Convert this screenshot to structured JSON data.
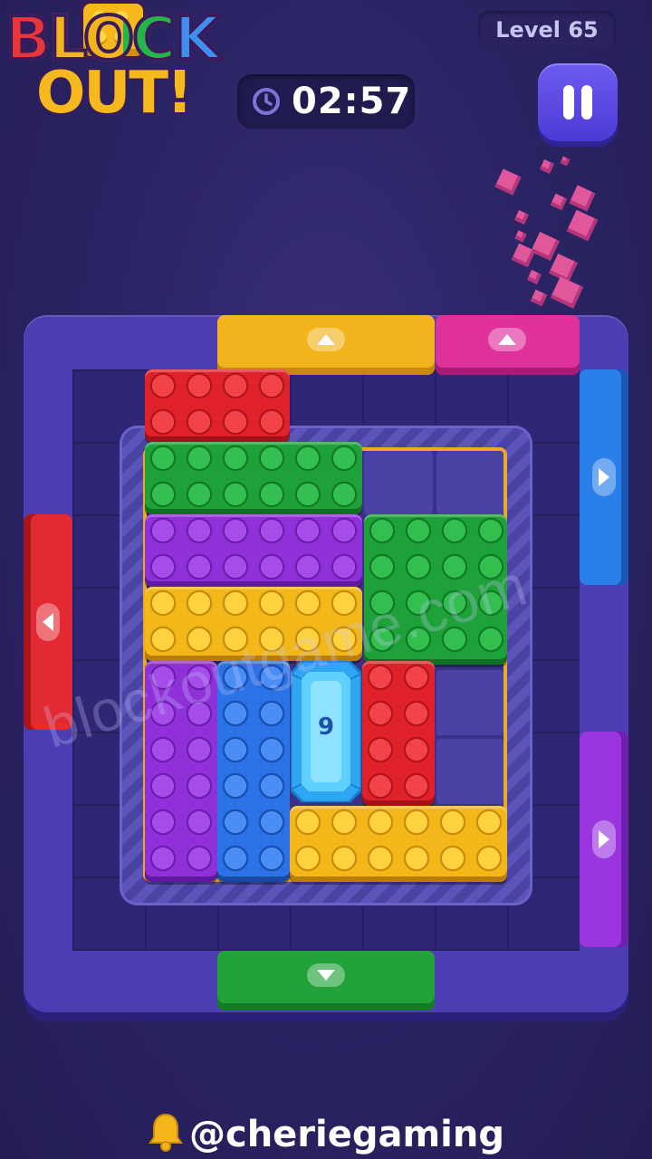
{
  "header": {
    "logo_line1": "BLOCK",
    "logo_line2": "OUT!",
    "level_label": "Level 65",
    "timer": "02:57",
    "timer_icon": "clock-icon",
    "pause_icon": "pause-icon"
  },
  "board": {
    "gates": [
      {
        "name": "gate-top-yellow",
        "color": "#f2b41c",
        "edge": "#c9890c",
        "direction": "up"
      },
      {
        "name": "gate-top-pink",
        "color": "#e0309a",
        "edge": "#a81d73",
        "direction": "up"
      },
      {
        "name": "gate-right-blue",
        "color": "#2a7fe8",
        "edge": "#1b58b3",
        "direction": "right"
      },
      {
        "name": "gate-right-purple",
        "color": "#9a35e0",
        "edge": "#6d1fae",
        "direction": "right"
      },
      {
        "name": "gate-left-red",
        "color": "#e22a33",
        "edge": "#a8161d",
        "direction": "left"
      },
      {
        "name": "gate-bottom-green",
        "color": "#21a33a",
        "edge": "#147a27",
        "direction": "down"
      }
    ],
    "blocks": [
      {
        "name": "block-red-top",
        "color": "red"
      },
      {
        "name": "block-green-wide",
        "color": "green"
      },
      {
        "name": "block-purple-wide",
        "color": "purple"
      },
      {
        "name": "block-green-square",
        "color": "green"
      },
      {
        "name": "block-yellow-wide",
        "color": "yellow"
      },
      {
        "name": "block-purple-tall",
        "color": "purple"
      },
      {
        "name": "block-blue-tall",
        "color": "blue"
      },
      {
        "name": "block-red-tall",
        "color": "red"
      },
      {
        "name": "block-yellow-bottom",
        "color": "yellow"
      }
    ],
    "gem": {
      "color": "light-blue",
      "counter": "9"
    }
  },
  "watermark": "blockoutgame.com",
  "footer": {
    "handle": "@cheriegaming",
    "icon": "bell-icon"
  }
}
